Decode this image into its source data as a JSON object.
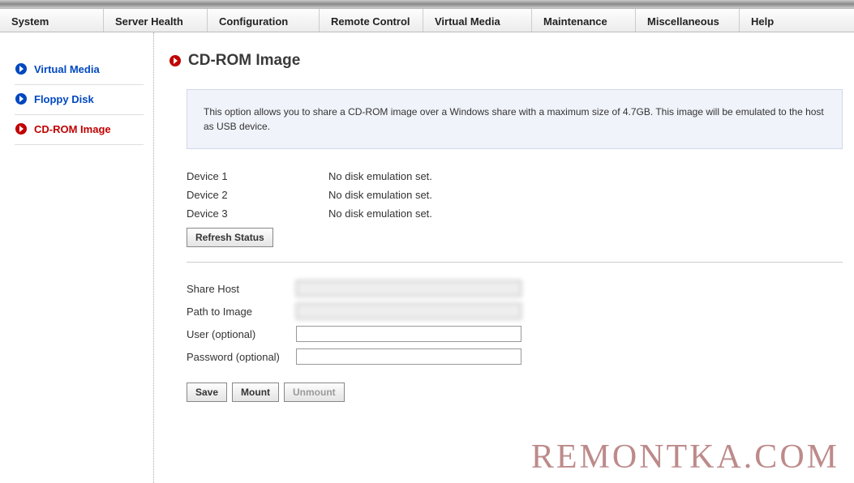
{
  "nav": {
    "system": "System",
    "server_health": "Server Health",
    "configuration": "Configuration",
    "remote_control": "Remote Control",
    "virtual_media": "Virtual Media",
    "maintenance": "Maintenance",
    "miscellaneous": "Miscellaneous",
    "help": "Help"
  },
  "sidebar": {
    "virtual_media": "Virtual Media",
    "floppy_disk": "Floppy Disk",
    "cdrom_image": "CD-ROM Image"
  },
  "page": {
    "title": "CD-ROM Image",
    "info": "This option allows you to share a CD-ROM image over a Windows share with a maximum size of 4.7GB. This image will be emulated to the host as USB device."
  },
  "devices": {
    "d1_label": "Device 1",
    "d1_status": "No disk emulation set.",
    "d2_label": "Device 2",
    "d2_status": "No disk emulation set.",
    "d3_label": "Device 3",
    "d3_status": "No disk emulation set.",
    "refresh_label": "Refresh Status"
  },
  "form": {
    "share_host_label": "Share Host",
    "share_host_value": "",
    "path_label": "Path to Image",
    "path_value": "",
    "user_label": "User (optional)",
    "user_value": "",
    "password_label": "Password (optional)",
    "password_value": ""
  },
  "actions": {
    "save": "Save",
    "mount": "Mount",
    "unmount": "Unmount"
  },
  "watermark": "REMONTKA.COM"
}
